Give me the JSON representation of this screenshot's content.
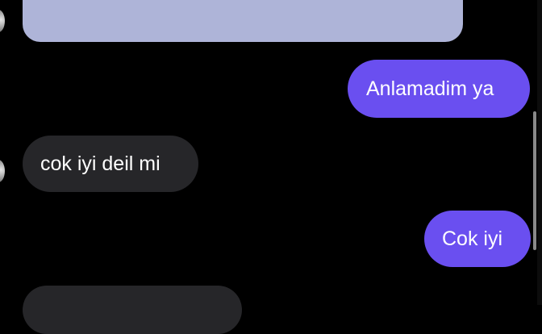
{
  "conversation": {
    "messages": [
      {
        "direction": "incoming",
        "type": "media",
        "text": ""
      },
      {
        "direction": "outgoing",
        "type": "text",
        "text": "Anlamadim ya"
      },
      {
        "direction": "incoming",
        "type": "text",
        "text": "cok iyi deil mi"
      },
      {
        "direction": "outgoing",
        "type": "text",
        "text": "Cok iyi"
      },
      {
        "direction": "incoming",
        "type": "text",
        "text": ""
      }
    ]
  },
  "colors": {
    "background": "#000000",
    "incoming_bubble": "#262629",
    "outgoing_bubble": "#6a4ff0",
    "media_placeholder": "#aeb4d8",
    "text": "#ffffff"
  }
}
